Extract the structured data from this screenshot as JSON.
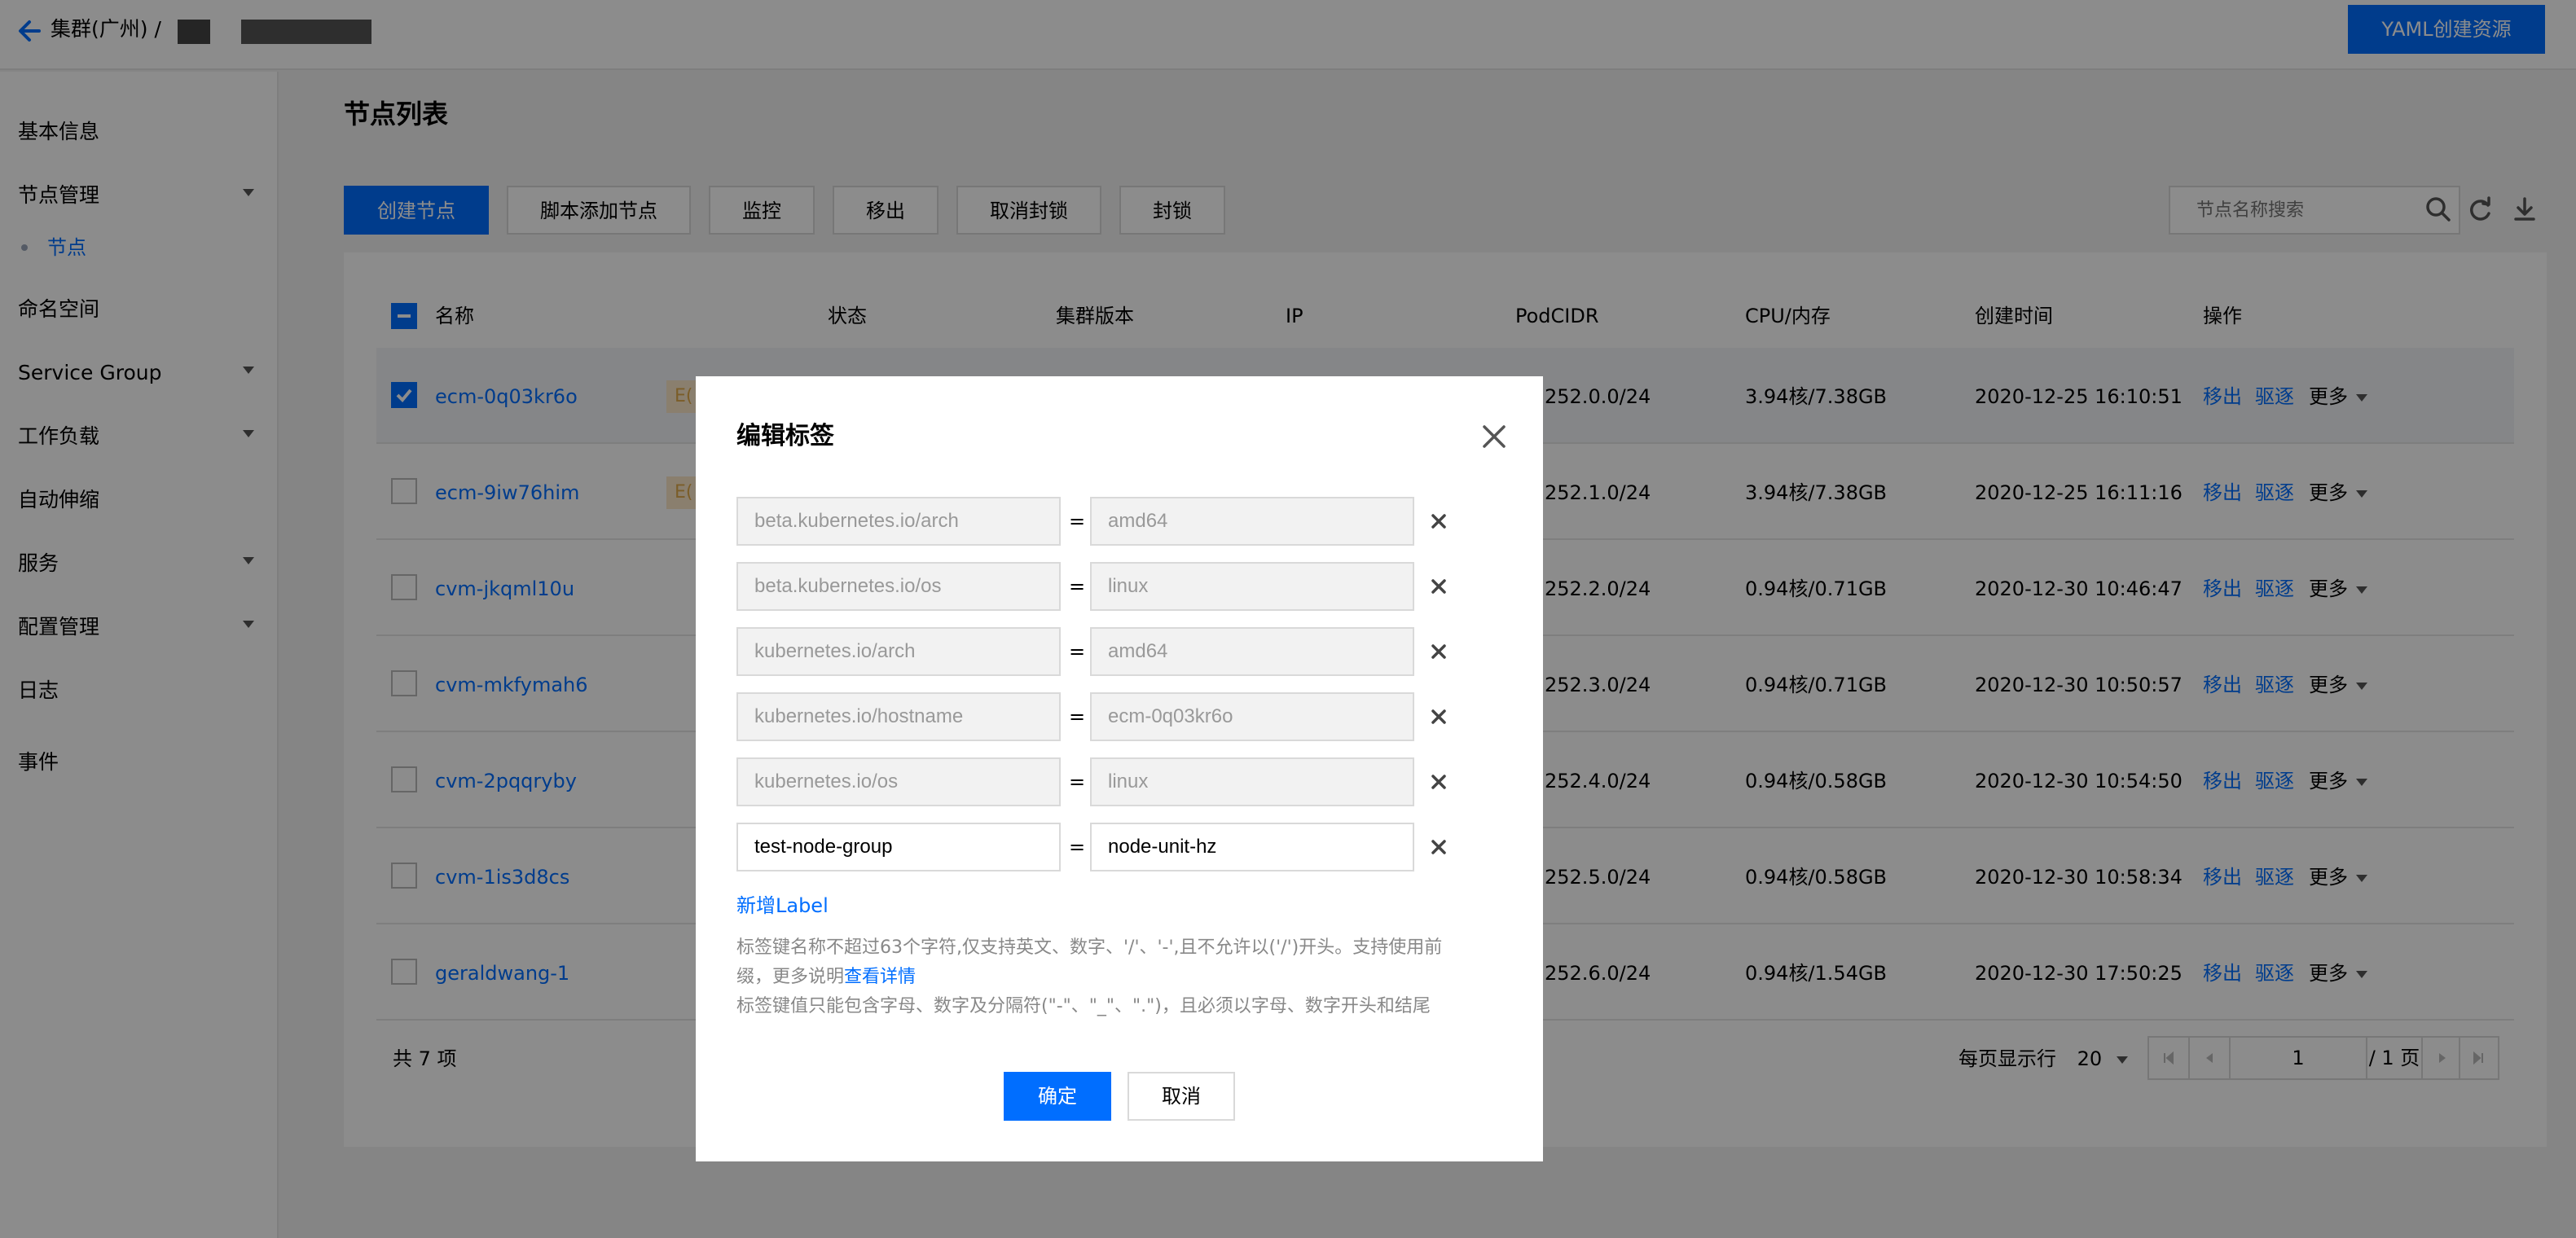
{
  "header": {
    "breadcrumb_root": "集群(广州) /",
    "yaml_button": "YAML创建资源"
  },
  "sidebar": {
    "items": [
      {
        "label": "基本信息"
      },
      {
        "label": "节点管理"
      },
      {
        "label": "节点"
      },
      {
        "label": "命名空间"
      },
      {
        "label": "Service Group"
      },
      {
        "label": "工作负载"
      },
      {
        "label": "自动伸缩"
      },
      {
        "label": "服务"
      },
      {
        "label": "配置管理"
      },
      {
        "label": "日志"
      },
      {
        "label": "事件"
      }
    ]
  },
  "main": {
    "title": "节点列表",
    "toolbar": [
      "创建节点",
      "脚本添加节点",
      "监控",
      "移出",
      "取消封锁",
      "封锁"
    ],
    "search_placeholder": "节点名称搜索"
  },
  "table": {
    "columns": [
      "名称",
      "状态",
      "集群版本",
      "IP",
      "PodCIDR",
      "CPU/内存",
      "创建时间",
      "操作"
    ],
    "rows": [
      {
        "name": "ecm-0q03kr6o",
        "tag": "E(",
        "podcidr": "252.0.0/24",
        "cpu": "3.94核/7.38GB",
        "created": "2020-12-25 16:10:51",
        "checked": true
      },
      {
        "name": "ecm-9iw76him",
        "tag": "E(",
        "podcidr": "252.1.0/24",
        "cpu": "3.94核/7.38GB",
        "created": "2020-12-25 16:11:16",
        "checked": false
      },
      {
        "name": "cvm-jkqml10u",
        "tag": "",
        "podcidr": "252.2.0/24",
        "cpu": "0.94核/0.71GB",
        "created": "2020-12-30 10:46:47",
        "checked": false
      },
      {
        "name": "cvm-mkfymah6",
        "tag": "",
        "podcidr": "252.3.0/24",
        "cpu": "0.94核/0.71GB",
        "created": "2020-12-30 10:50:57",
        "checked": false
      },
      {
        "name": "cvm-2pqqryby",
        "tag": "",
        "podcidr": "252.4.0/24",
        "cpu": "0.94核/0.58GB",
        "created": "2020-12-30 10:54:50",
        "checked": false
      },
      {
        "name": "cvm-1is3d8cs",
        "tag": "",
        "podcidr": "252.5.0/24",
        "cpu": "0.94核/0.58GB",
        "created": "2020-12-30 10:58:34",
        "checked": false
      },
      {
        "name": "geraldwang-1",
        "tag": "",
        "podcidr": "252.6.0/24",
        "cpu": "0.94核/1.54GB",
        "created": "2020-12-30 17:50:25",
        "checked": false
      }
    ],
    "actions": {
      "remove": "移出",
      "drain": "驱逐",
      "more": "更多"
    }
  },
  "pagination": {
    "total": "共 7 项",
    "per_page_label": "每页显示行",
    "per_page_value": "20",
    "page_input": "1",
    "page_total": "/ 1 页"
  },
  "dialog": {
    "title": "编辑标签",
    "labels": [
      {
        "key": "beta.kubernetes.io/arch",
        "value": "amd64",
        "editable": false
      },
      {
        "key": "beta.kubernetes.io/os",
        "value": "linux",
        "editable": false
      },
      {
        "key": "kubernetes.io/arch",
        "value": "amd64",
        "editable": false
      },
      {
        "key": "kubernetes.io/hostname",
        "value": "ecm-0q03kr6o",
        "editable": false
      },
      {
        "key": "kubernetes.io/os",
        "value": "linux",
        "editable": false
      },
      {
        "key": "test-node-group",
        "value": "node-unit-hz",
        "editable": true
      }
    ],
    "equals": "=",
    "add_label": "新增Label",
    "help_line1": "标签键名称不超过63个字符,仅支持英文、数字、'/'、'-',且不允许以('/')开头。支持使用前",
    "help_line2_prefix": "缀，更多说明",
    "help_link": "查看详情",
    "help_line3": "标签键值只能包含字母、数字及分隔符(\"-\"、\"_\"、\".\")，且必须以字母、数字开头和结尾",
    "ok": "确定",
    "cancel": "取消"
  }
}
